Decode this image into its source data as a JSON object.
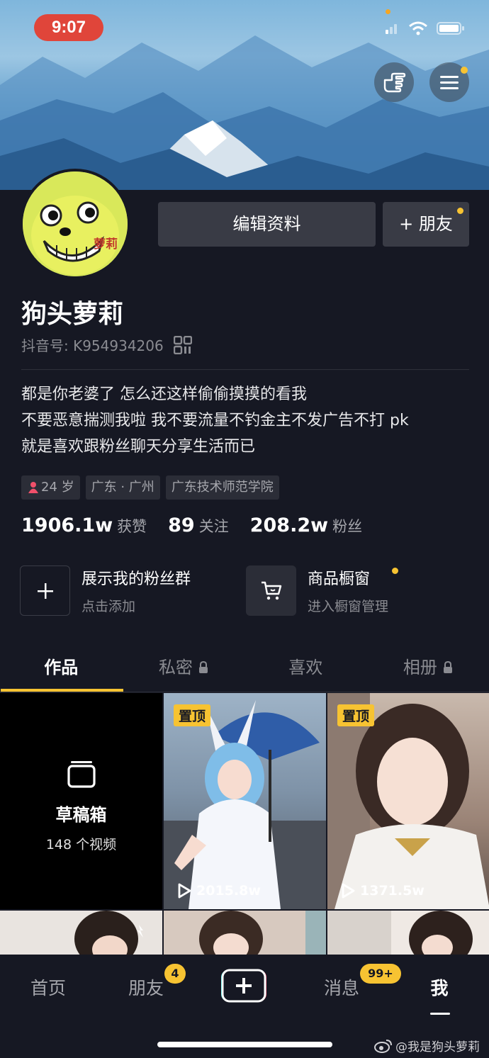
{
  "status_bar": {
    "time": "9:07"
  },
  "profile": {
    "nickname": "狗头萝莉",
    "account_label": "抖音号: K954934206",
    "avatar_text": "萝莉",
    "edit_button": "编辑资料",
    "add_friend_button": "+ 朋友",
    "bio": [
      "都是你老婆了 怎么还这样偷偷摸摸的看我",
      "不要恶意揣测我啦 我不要流量不钓金主不发广告不打 pk",
      "就是喜欢跟粉丝聊天分享生活而已"
    ],
    "tags": [
      "24 岁",
      "广东 · 广州",
      "广东技术师范学院"
    ],
    "stats": [
      {
        "num": "1906.1w",
        "label": "获赞"
      },
      {
        "num": "89",
        "label": "关注"
      },
      {
        "num": "208.2w",
        "label": "粉丝"
      }
    ]
  },
  "features": {
    "fan_group": {
      "title": "展示我的粉丝群",
      "sub": "点击添加"
    },
    "shop": {
      "title": "商品橱窗",
      "sub": "进入橱窗管理"
    }
  },
  "tabs": [
    "作品",
    "私密",
    "喜欢",
    "相册"
  ],
  "grid": {
    "draft": {
      "title": "草稿箱",
      "sub": "148 个视频"
    },
    "videos": [
      {
        "pin": "置顶",
        "plays": "2015.8w"
      },
      {
        "pin": "置顶",
        "plays": "1371.5w"
      }
    ]
  },
  "bottom_nav": {
    "home": "首页",
    "friends": "朋友",
    "friends_badge": "4",
    "messages": "消息",
    "messages_badge": "99+",
    "me": "我"
  },
  "watermark": "@我是狗头萝莉",
  "colors": {
    "accent": "#f7c332",
    "background": "#161823",
    "time_pill": "#e0453a"
  }
}
